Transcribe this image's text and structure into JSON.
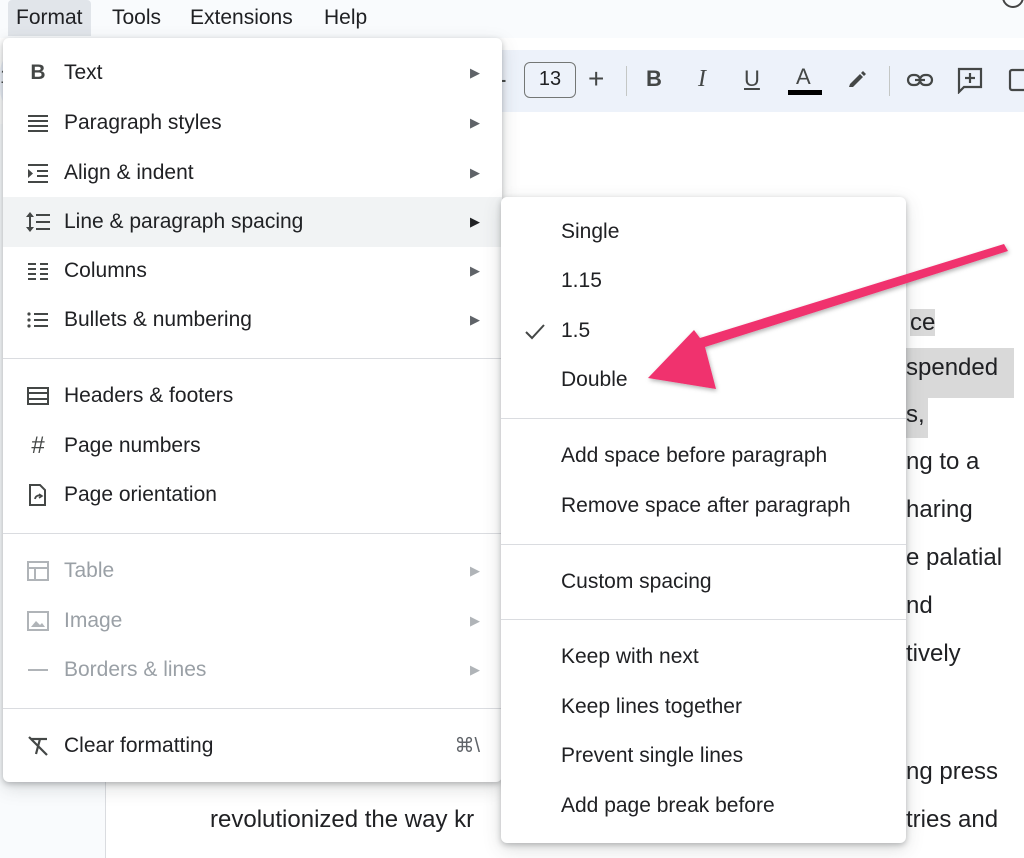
{
  "menubar": {
    "items": [
      "Format",
      "Tools",
      "Extensions",
      "Help"
    ]
  },
  "toolbar": {
    "font_size": "13",
    "minus_label": "-",
    "plus_label": "+",
    "bold_label": "B",
    "italic_label": "I",
    "underline_label": "U",
    "text_color_label": "A",
    "text_color_bar": "#000000",
    "left_fragment": "1"
  },
  "format_menu": {
    "items": [
      {
        "label": "Text",
        "icon": "bold-icon",
        "submenu": true
      },
      {
        "label": "Paragraph styles",
        "icon": "paragraph-styles-icon",
        "submenu": true
      },
      {
        "label": "Align & indent",
        "icon": "indent-icon",
        "submenu": true
      },
      {
        "label": "Line & paragraph spacing",
        "icon": "line-spacing-icon",
        "submenu": true
      },
      {
        "label": "Columns",
        "icon": "columns-icon",
        "submenu": true
      },
      {
        "label": "Bullets & numbering",
        "icon": "bulleted-list-icon",
        "submenu": true
      },
      {
        "label": "Headers & footers",
        "icon": "header-footer-icon",
        "submenu": false
      },
      {
        "label": "Page numbers",
        "icon": "hash-icon",
        "submenu": false
      },
      {
        "label": "Page orientation",
        "icon": "page-orientation-icon",
        "submenu": false
      },
      {
        "label": "Table",
        "icon": "table-icon",
        "submenu": true,
        "disabled": true
      },
      {
        "label": "Image",
        "icon": "image-icon",
        "submenu": true,
        "disabled": true
      },
      {
        "label": "Borders & lines",
        "icon": "borders-icon",
        "submenu": true,
        "disabled": true
      },
      {
        "label": "Clear formatting",
        "icon": "clear-formatting-icon",
        "submenu": false,
        "shortcut": "⌘\\"
      }
    ]
  },
  "spacing_submenu": {
    "items": [
      {
        "label": "Single"
      },
      {
        "label": "1.15"
      },
      {
        "label": "1.5",
        "checked": true
      },
      {
        "label": "Double"
      },
      {
        "label": "Add space before paragraph"
      },
      {
        "label": "Remove space after paragraph"
      },
      {
        "label": "Custom spacing"
      },
      {
        "label": "Keep with next"
      },
      {
        "label": "Keep lines together"
      },
      {
        "label": "Prevent single lines"
      },
      {
        "label": "Add page break before"
      }
    ]
  },
  "document": {
    "visible_fragments": [
      "ce",
      "spended",
      "s,",
      "ng to a",
      "haring",
      "e palatial",
      "nd",
      "tively",
      "ng press",
      "revolutionized the way kr",
      "tries and"
    ]
  },
  "colors": {
    "annotation_arrow": "#f0306e",
    "highlight": "#d9d9d9",
    "menu_hover": "#f1f3f4"
  }
}
